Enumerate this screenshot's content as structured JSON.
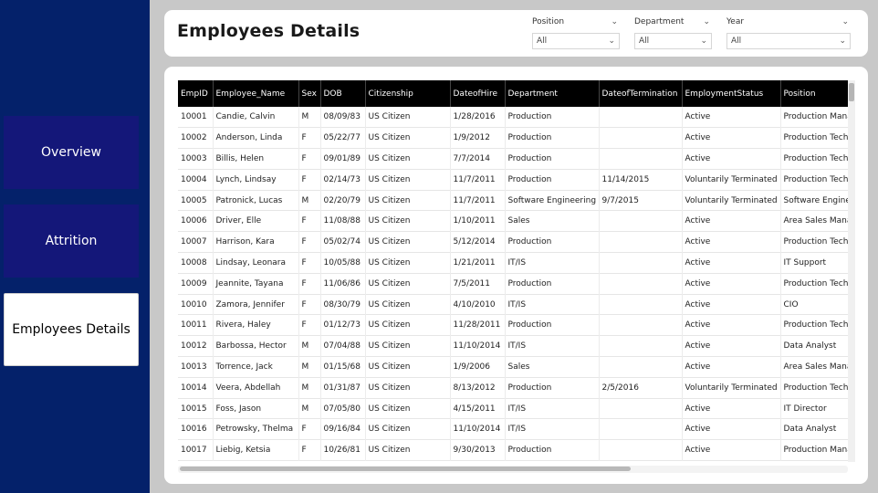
{
  "nav": {
    "items": [
      {
        "label": "Overview"
      },
      {
        "label": "Attrition"
      },
      {
        "label": "Employees Details"
      }
    ]
  },
  "header": {
    "title": "Employees Details"
  },
  "filters": {
    "position": {
      "label": "Position",
      "value": "All"
    },
    "department": {
      "label": "Department",
      "value": "All"
    },
    "year": {
      "label": "Year",
      "value": "All"
    }
  },
  "table": {
    "columns": [
      "EmpID",
      "Employee_Name",
      "Sex",
      "DOB",
      "Citizenship",
      "DateofHire",
      "Department",
      "DateofTermination",
      "EmploymentStatus",
      "Position"
    ],
    "rows": [
      [
        "10001",
        "Candie, Calvin",
        "M",
        "08/09/83",
        "US Citizen",
        "1/28/2016",
        "Production",
        "",
        "Active",
        "Production Manager"
      ],
      [
        "10002",
        "Anderson, Linda",
        "F",
        "05/22/77",
        "US Citizen",
        "1/9/2012",
        "Production",
        "",
        "Active",
        "Production Technician"
      ],
      [
        "10003",
        "Billis, Helen",
        "F",
        "09/01/89",
        "US Citizen",
        "7/7/2014",
        "Production",
        "",
        "Active",
        "Production Technician"
      ],
      [
        "10004",
        "Lynch, Lindsay",
        "F",
        "02/14/73",
        "US Citizen",
        "11/7/2011",
        "Production",
        "11/14/2015",
        "Voluntarily Terminated",
        "Production Technician"
      ],
      [
        "10005",
        "Patronick, Lucas",
        "M",
        "02/20/79",
        "US Citizen",
        "11/7/2011",
        "Software Engineering",
        "9/7/2015",
        "Voluntarily Terminated",
        "Software Engineer"
      ],
      [
        "10006",
        "Driver, Elle",
        "F",
        "11/08/88",
        "US Citizen",
        "1/10/2011",
        "Sales",
        "",
        "Active",
        "Area Sales Manager"
      ],
      [
        "10007",
        "Harrison, Kara",
        "F",
        "05/02/74",
        "US Citizen",
        "5/12/2014",
        "Production",
        "",
        "Active",
        "Production Technician"
      ],
      [
        "10008",
        "Lindsay, Leonara",
        "F",
        "10/05/88",
        "US Citizen",
        "1/21/2011",
        "IT/IS",
        "",
        "Active",
        "IT Support"
      ],
      [
        "10009",
        "Jeannite, Tayana",
        "F",
        "11/06/86",
        "US Citizen",
        "7/5/2011",
        "Production",
        "",
        "Active",
        "Production Technician"
      ],
      [
        "10010",
        "Zamora, Jennifer",
        "F",
        "08/30/79",
        "US Citizen",
        "4/10/2010",
        "IT/IS",
        "",
        "Active",
        "CIO"
      ],
      [
        "10011",
        "Rivera, Haley",
        "F",
        "01/12/73",
        "US Citizen",
        "11/28/2011",
        "Production",
        "",
        "Active",
        "Production Technician"
      ],
      [
        "10012",
        "Barbossa, Hector",
        "M",
        "07/04/88",
        "US Citizen",
        "11/10/2014",
        "IT/IS",
        "",
        "Active",
        "Data Analyst"
      ],
      [
        "10013",
        "Torrence, Jack",
        "M",
        "01/15/68",
        "US Citizen",
        "1/9/2006",
        "Sales",
        "",
        "Active",
        "Area Sales Manager"
      ],
      [
        "10014",
        "Veera, Abdellah",
        "M",
        "01/31/87",
        "US Citizen",
        "8/13/2012",
        "Production",
        "2/5/2016",
        "Voluntarily Terminated",
        "Production Technician"
      ],
      [
        "10015",
        "Foss, Jason",
        "M",
        "07/05/80",
        "US Citizen",
        "4/15/2011",
        "IT/IS",
        "",
        "Active",
        "IT Director"
      ],
      [
        "10016",
        "Petrowsky, Thelma",
        "F",
        "09/16/84",
        "US Citizen",
        "11/10/2014",
        "IT/IS",
        "",
        "Active",
        "Data Analyst"
      ],
      [
        "10017",
        "Liebig, Ketsia",
        "F",
        "10/26/81",
        "US Citizen",
        "9/30/2013",
        "Production",
        "",
        "Active",
        "Production Manager"
      ]
    ]
  },
  "colors": {
    "sidebar_bg": "#04216a",
    "nav_inactive_bg": "#141779",
    "nav_active_bg": "#ffffff",
    "table_header_bg": "#000000"
  }
}
